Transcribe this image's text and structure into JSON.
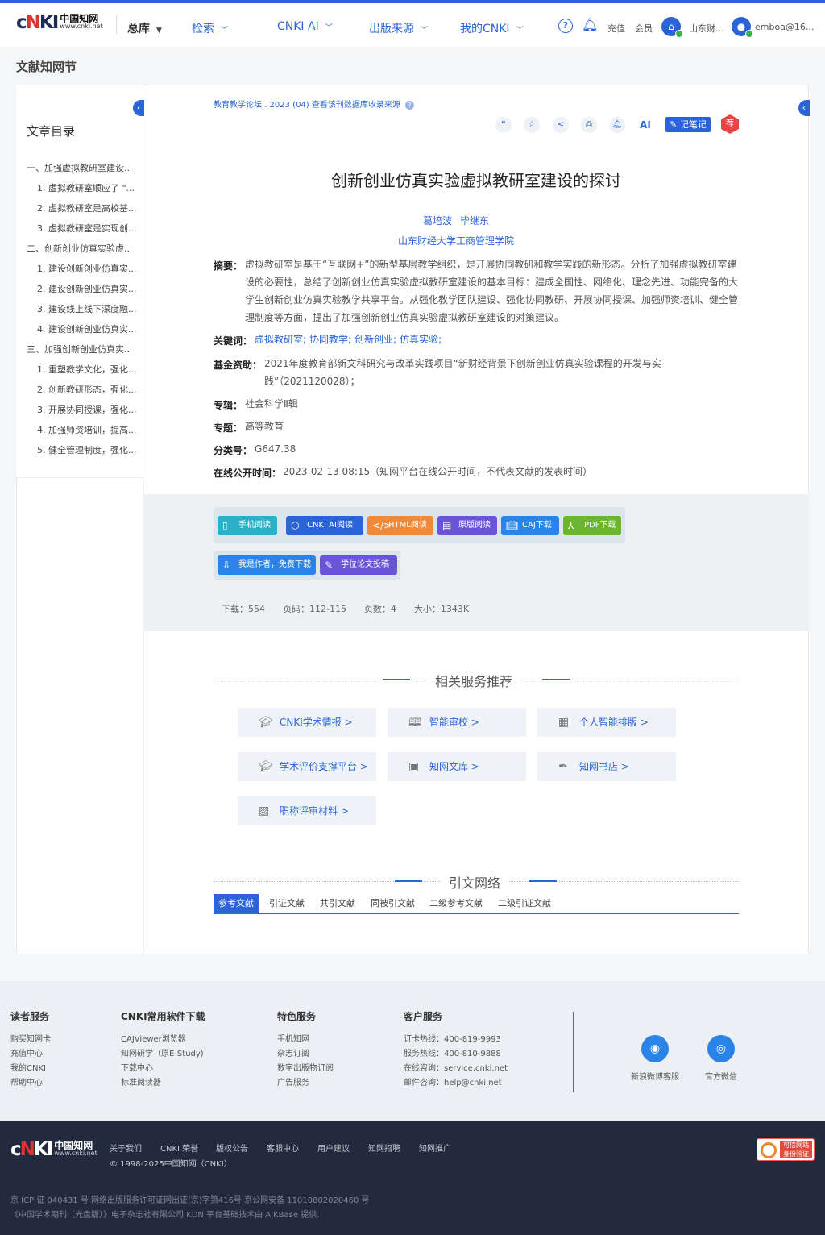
{
  "header": {
    "logo_sub": "www.cnki.net",
    "logo_cn": "中国知网",
    "nav": [
      {
        "label": "总库"
      },
      {
        "label": "检索"
      },
      {
        "label": "CNKI AI"
      },
      {
        "label": "出版来源"
      },
      {
        "label": "我的CNKI"
      }
    ],
    "recharge": "充值",
    "member": "会员",
    "institution": "山东财...",
    "user": "emboa@16..."
  },
  "page_title": "文献知网节",
  "toc": {
    "title": "文章目录",
    "items": [
      {
        "label": "一、加强虚拟教研室建设..."
      },
      {
        "label": "1. 虚拟教研室顺应了 \"..."
      },
      {
        "label": "2. 虚拟教研室是高校基..."
      },
      {
        "label": "3. 虚拟教研室是实现创..."
      },
      {
        "label": "二、创新创业仿真实验虚..."
      },
      {
        "label": "1. 建设创新创业仿真实..."
      },
      {
        "label": "2. 建设创新创业仿真实..."
      },
      {
        "label": "3. 建设线上线下深度融..."
      },
      {
        "label": "4. 建设创新创业仿真实..."
      },
      {
        "label": "三、加强创新创业仿真实..."
      },
      {
        "label": "1. 重塑教学文化，强化..."
      },
      {
        "label": "2. 创新教研形态，强化..."
      },
      {
        "label": "3. 开展协同授课，强化..."
      },
      {
        "label": "4. 加强师资培训，提高..."
      },
      {
        "label": "5. 健全管理制度，强化..."
      }
    ]
  },
  "article": {
    "source": "教育教学论坛 . 2023 (04)  查看该刊数据库收录来源",
    "note_label": "记笔记",
    "rec_label": "荐",
    "ai_label": "AI",
    "title": "创新创业仿真实验虚拟教研室建设的探讨",
    "authors": "葛培波 毕继东",
    "org": "山东财经大学工商管理学院",
    "abstract_label": "摘要：",
    "abstract": "虚拟教研室是基于“互联网+”的新型基层教学组织，是开展协同教研和教学实践的新形态。分析了加强虚拟教研室建设的必要性，总结了创新创业仿真实验虚拟教研室建设的基本目标：建成全国性、网络化、理念先进、功能完备的大学生创新创业仿真实验教学共享平台。从强化教学团队建设、强化协同教研、开展协同授课、加强师资培训、健全管理制度等方面，提出了加强创新创业仿真实验虚拟教研室建设的对策建议。",
    "keywords_label": "关键词：",
    "keywords": [
      "虚拟教研室;",
      "协同教学;",
      "创新创业;",
      "仿真实验;"
    ],
    "fund_label": "基金资助：",
    "fund": "2021年度教育部新文科研究与改革实践项目“新财经背景下创新创业仿真实验课程的开发与实践”（2021120028）；",
    "series_label": "专辑：",
    "series": "社会科学Ⅱ辑",
    "topic_label": "专题：",
    "topic": "高等教育",
    "clc_label": "分类号：",
    "clc": "G647.38",
    "pubtime_label": "在线公开时间：",
    "pubtime": "2023-02-13 08:15（知网平台在线公开时间，不代表文献的发表时间）"
  },
  "actions": {
    "buttons": [
      {
        "label": "手机阅读",
        "color": "#2bb0c8"
      },
      {
        "label": "CNKI AI阅读",
        "color": "#2a64d8"
      },
      {
        "label": "HTML阅读",
        "color": "#ef8a3a"
      },
      {
        "label": "原版阅读",
        "color": "#6a55d8"
      },
      {
        "label": "CAJ下载",
        "color": "#2a84e8"
      },
      {
        "label": "PDF下载",
        "color": "#6cb52f"
      },
      {
        "label": "我是作者，免费下载",
        "color": "#2a84e8"
      },
      {
        "label": "学位论文投稿",
        "color": "#6a55d8"
      }
    ],
    "stats": "下载：554    页码：112-115    页数：4    大小：1343K"
  },
  "services": {
    "title": "相关服务推荐",
    "items": [
      {
        "label": "CNKI学术情报 >",
        "icon": "mortarboard-icon"
      },
      {
        "label": "智能审校 >",
        "icon": "book-icon"
      },
      {
        "label": "个人智能排版 >",
        "icon": "layout-icon"
      },
      {
        "label": "学术评价支撑平台 >",
        "icon": "academic-cap-icon"
      },
      {
        "label": "知网文库 >",
        "icon": "library-icon"
      },
      {
        "label": "知网书店 >",
        "icon": "bookstore-icon"
      },
      {
        "label": "职称评审材料 >",
        "icon": "certificate-icon"
      }
    ]
  },
  "citations": {
    "title": "引文网络",
    "tabs": [
      {
        "label": "参考文献"
      },
      {
        "label": "引证文献"
      },
      {
        "label": "共引文献"
      },
      {
        "label": "同被引文献"
      },
      {
        "label": "二级参考文献"
      },
      {
        "label": "二级引证文献"
      }
    ]
  },
  "footer": {
    "col1": {
      "title": "读者服务",
      "links": [
        "购买知网卡",
        "充值中心",
        "我的CNKI",
        "帮助中心"
      ]
    },
    "col2": {
      "title": "CNKI常用软件下载",
      "links": [
        "CAJViewer浏览器",
        "知网研学（原E-Study)",
        "下载中心",
        "标准阅读器"
      ]
    },
    "col3": {
      "title": "特色服务",
      "links": [
        "手机知网",
        "杂志订阅",
        "数字出版物订阅",
        "广告服务"
      ]
    },
    "col4": {
      "title": "客户服务",
      "links": [
        "订卡热线：400-819-9993",
        "服务热线：400-810-9888",
        "在线咨询：service.cnki.net",
        "邮件咨询：help@cnki.net"
      ]
    },
    "weibo": "新浪微博客服",
    "wechat": "官方微信",
    "links": [
      "关于我们",
      "CNKI 荣誉",
      "版权公告",
      "客服中心",
      "用户建议",
      "知网招聘",
      "知网推广"
    ],
    "copyright": "© 1998-2025中国知网（CNKI）",
    "icp": "京 ICP 证 040431 号  网络出版服务许可证网出证(京)字第416号  京公网安备 11010802020460 号",
    "company": "《中国学术期刊（光盘版）》电子杂志社有限公司  KDN 平台基础技术由 AIKBase 提供.",
    "badge_text": "可信网站 身份验证"
  }
}
